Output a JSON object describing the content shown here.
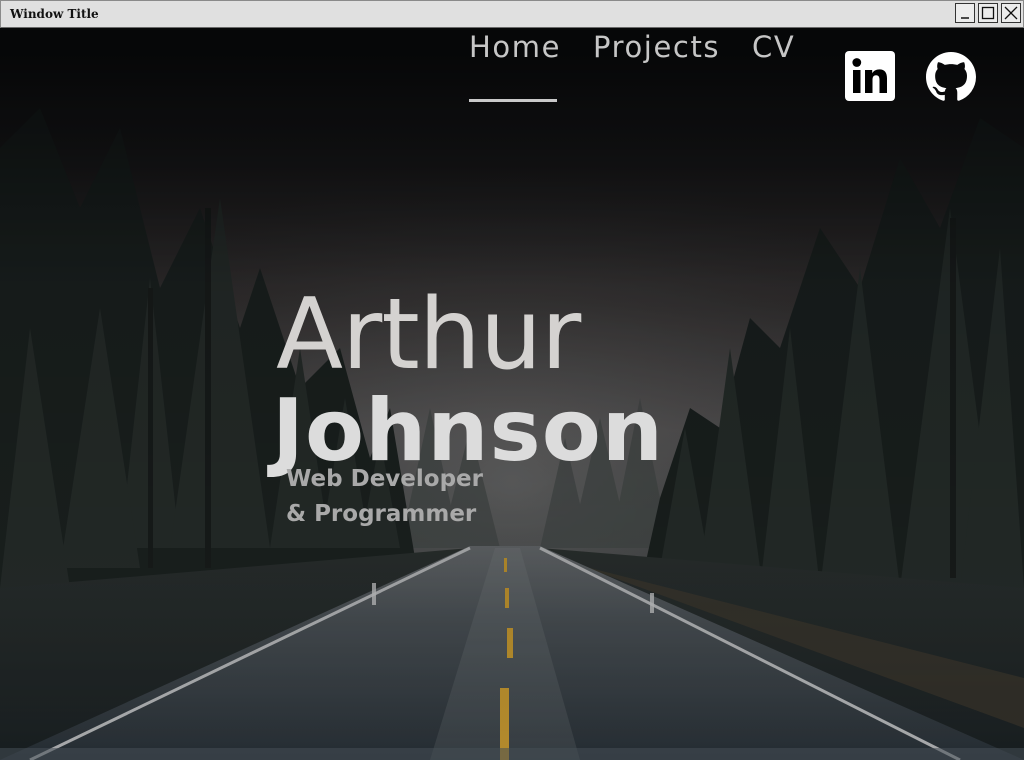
{
  "window": {
    "title": "Window Title",
    "buttons": [
      "minimize-icon",
      "maximize-icon",
      "close-icon"
    ]
  },
  "nav": {
    "links": [
      {
        "label": "Home",
        "active": true
      },
      {
        "label": "Projects",
        "active": false
      },
      {
        "label": "CV",
        "active": false
      }
    ],
    "social": [
      {
        "icon": "linkedin-icon"
      },
      {
        "icon": "github-icon"
      }
    ]
  },
  "hero": {
    "first_name": "Arthur",
    "last_name": "Johnson",
    "subtitle_line1": "Web Developer",
    "subtitle_line2": "& Programmer"
  },
  "colors": {
    "text_light": "#d4d2d0",
    "subtitle": "#a9a9a9",
    "nav_text": "#c6c6c6",
    "road_line": "#d8a531"
  }
}
